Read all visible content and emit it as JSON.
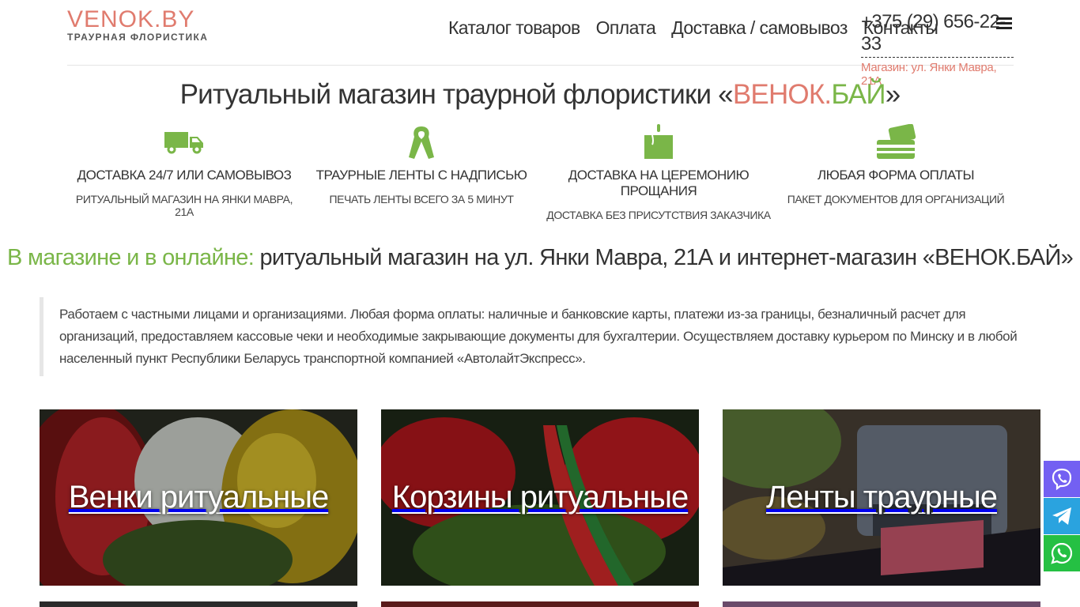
{
  "header": {
    "logo_main": "VENOK.BY",
    "logo_sub": "ТРАУРНАЯ ФЛОРИСТИКА",
    "nav": [
      "Каталог товаров",
      "Оплата",
      "Доставка / самовывоз",
      "Контакты"
    ],
    "phone": "+375 (29) 656-22-33",
    "address": "Магазин: ул. Янки Мавра, 21А",
    "menu_icon": "hamburger-menu-icon"
  },
  "hero": {
    "title_pre": "Ритуальный магазин траурной флористики «",
    "brand_part1": "ВЕНОК.",
    "brand_part2": "БАЙ",
    "title_post": "»"
  },
  "features": [
    {
      "icon": "delivery-truck-icon",
      "title": "ДОСТАВКА 24/7 ИЛИ САМОВЫВОЗ",
      "subtitle": "РИТУАЛЬНЫЙ МАГАЗИН НА ЯНКИ МАВРА, 21А"
    },
    {
      "icon": "ribbon-icon",
      "title": "ТРАУРНЫЕ ЛЕНТЫ С НАДПИСЬЮ",
      "subtitle": "ПЕЧАТЬ ЛЕНТЫ ВСЕГО ЗА 5 МИНУТ"
    },
    {
      "icon": "candle-icon",
      "title": "ДОСТАВКА НА ЦЕРЕМОНИЮ ПРОЩАНИЯ",
      "subtitle": "ДОСТАВКА БЕЗ ПРИСУТСТВИЯ ЗАКАЗЧИКА"
    },
    {
      "icon": "cards-payment-icon",
      "title": "ЛЮБАЯ ФОРМА ОПЛАТЫ",
      "subtitle": "ПАКЕТ ДОКУМЕНТОВ ДЛЯ ОРГАНИЗАЦИЙ"
    }
  ],
  "section": {
    "accent": "В магазине и в онлайне:",
    "rest": " ритуальный магазин на ул. Янки Мавра, 21А и интернет-магазин «ВЕНОК.БАЙ»"
  },
  "quote": "Работаем с частными лицами и организациями. Любая форма оплаты: наличные и банковские карты, платежи из-за границы, безналичный расчет для организаций, предоставляем кассовые чеки и необходимые закрывающие документы для бухгалтерии. Осуществляем доставку курьером по Минску и в любой населенный пункт Республики Беларусь транспортной компанией «АвтолайтЭкспресс».",
  "categories": [
    "Венки ритуальные",
    "Корзины ритуальные",
    "Ленты траурные"
  ],
  "social": [
    "viber-icon",
    "telegram-icon",
    "whatsapp-icon"
  ],
  "colors": {
    "brand_red": "#e07b6e",
    "brand_green": "#7ab648",
    "viber": "#7360f2",
    "telegram": "#2aa3df",
    "whatsapp": "#25c043"
  }
}
